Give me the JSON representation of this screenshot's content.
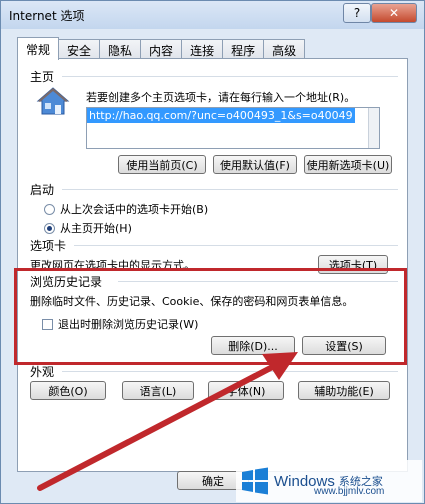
{
  "window": {
    "title": "Internet 选项",
    "help_label": "?",
    "close_label": "✕"
  },
  "tabs": [
    {
      "label": "常规",
      "active": true
    },
    {
      "label": "安全"
    },
    {
      "label": "隐私"
    },
    {
      "label": "内容"
    },
    {
      "label": "连接"
    },
    {
      "label": "程序"
    },
    {
      "label": "高级"
    }
  ],
  "homepage": {
    "section_label": "主页",
    "description": "若要创建多个主页选项卡，请在每行输入一个地址(R)。",
    "url": "http://hao.qq.com/?unc=o400493_1&s=o40049",
    "buttons": {
      "current": "使用当前页(C)",
      "default": "使用默认值(F)",
      "new_tab": "使用新选项卡(U)"
    },
    "icon": "house-icon"
  },
  "startup": {
    "section_label": "启动",
    "option_last": "从上次会话中的选项卡开始(B)",
    "option_home": "从主页开始(H)",
    "selected": "option_home"
  },
  "tabs_section": {
    "section_label": "选项卡",
    "description": "更改网页在选项卡中的显示方式。",
    "button": "选项卡(T)"
  },
  "history": {
    "section_label": "浏览历史记录",
    "description": "删除临时文件、历史记录、Cookie、保存的密码和网页表单信息。",
    "checkbox_label": "退出时删除浏览历史记录(W)",
    "checked": false,
    "delete_button": "删除(D)...",
    "settings_button": "设置(S)"
  },
  "appearance": {
    "section_label": "外观",
    "buttons": {
      "colors": "颜色(O)",
      "languages": "语言(L)",
      "fonts": "字体(N)",
      "accessibility": "辅助功能(E)"
    }
  },
  "footer": {
    "ok_button": "确定"
  },
  "annotation": {
    "highlight_color": "#c0282c"
  },
  "watermark": {
    "brand": "Windows",
    "sub": "系统之家",
    "url": "www.bjjmlv.com"
  }
}
